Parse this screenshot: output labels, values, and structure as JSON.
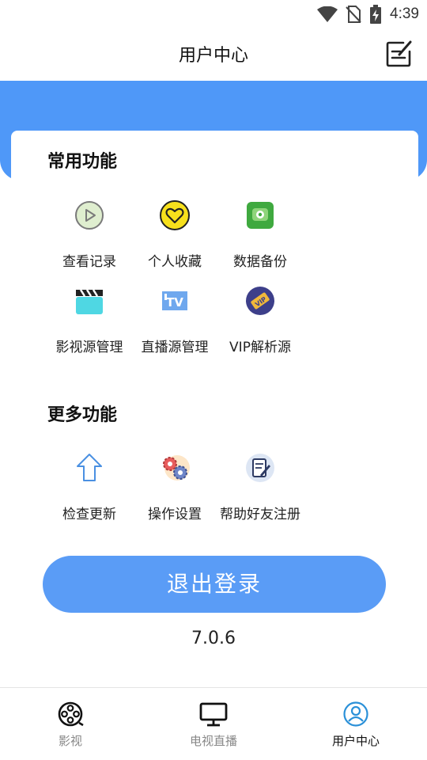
{
  "status_bar": {
    "time": "4:39",
    "icons": [
      "wifi-icon",
      "no-sim-icon",
      "battery-charging-icon"
    ]
  },
  "header": {
    "title": "用户中心",
    "edit_icon": "edit-icon"
  },
  "common_section": {
    "title": "常用功能",
    "items": [
      {
        "label": "查看记录",
        "icon": "play-history-icon"
      },
      {
        "label": "个人收藏",
        "icon": "heart-favorite-icon"
      },
      {
        "label": "数据备份",
        "icon": "backup-icon"
      },
      {
        "label": "影视源管理",
        "icon": "clapperboard-icon"
      },
      {
        "label": "直播源管理",
        "icon": "tv-icon"
      },
      {
        "label": "VIP解析源",
        "icon": "vip-icon"
      }
    ]
  },
  "more_section": {
    "title": "更多功能",
    "items": [
      {
        "label": "检查更新",
        "icon": "upload-arrow-icon"
      },
      {
        "label": "操作设置",
        "icon": "gears-icon"
      },
      {
        "label": "帮助好友注册",
        "icon": "notepad-pen-icon"
      }
    ]
  },
  "logout_label": "退出登录",
  "version": "7.0.6",
  "bottom_nav": [
    {
      "label": "影视",
      "icon": "film-reel-icon",
      "active": false
    },
    {
      "label": "电视直播",
      "icon": "monitor-icon",
      "active": false
    },
    {
      "label": "用户中心",
      "icon": "user-circle-icon",
      "active": true
    }
  ],
  "colors": {
    "accent": "#4f98f8",
    "button": "#5a9cf6",
    "active_nav": "#2a90d8"
  }
}
